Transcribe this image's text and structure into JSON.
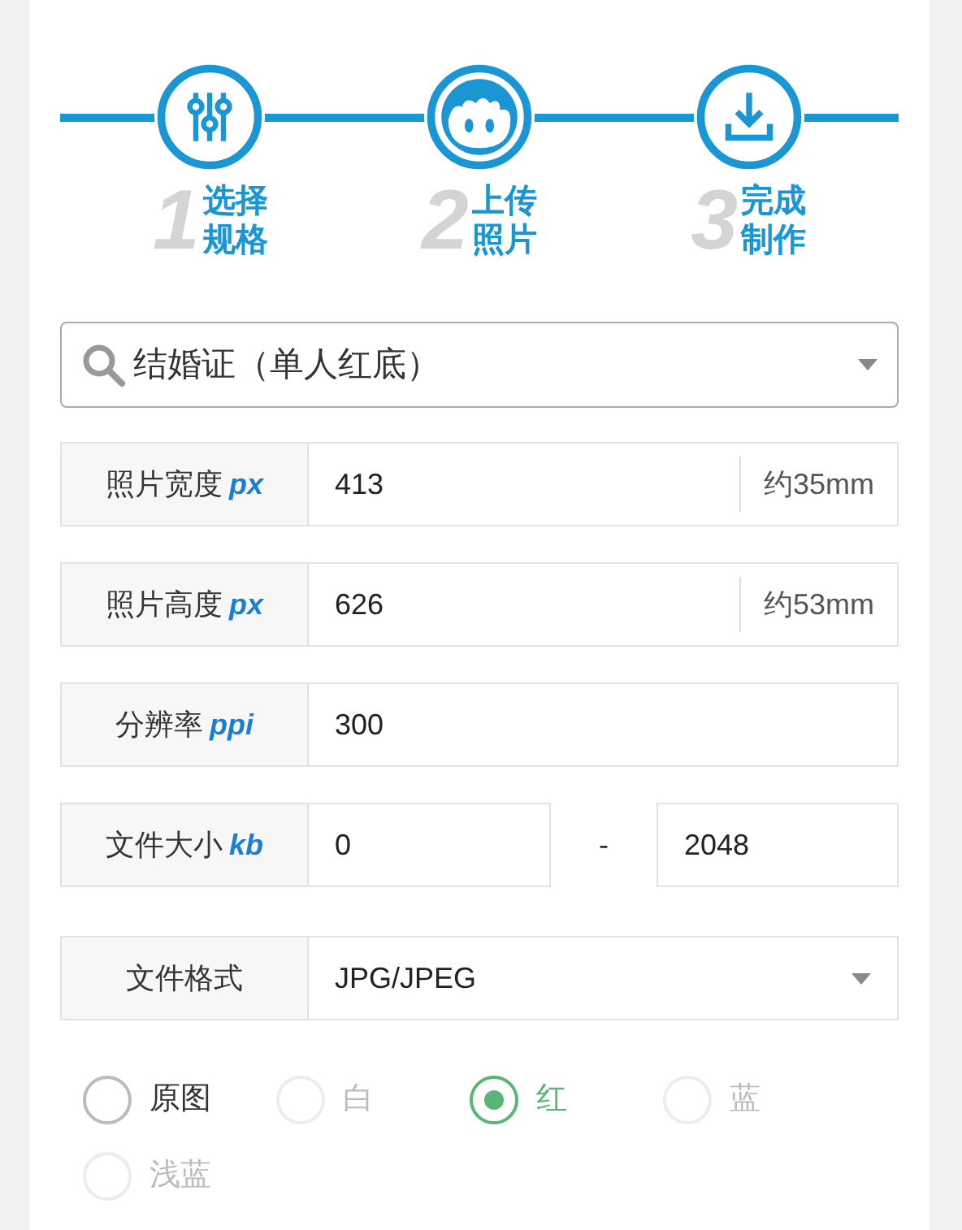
{
  "steps": [
    {
      "number": "1",
      "line1": "选择",
      "line2": "规格",
      "kind": "sliders"
    },
    {
      "number": "2",
      "line1": "上传",
      "line2": "照片",
      "kind": "face"
    },
    {
      "number": "3",
      "line1": "完成",
      "line2": "制作",
      "kind": "download"
    }
  ],
  "spec_select": {
    "value": "结婚证（单人红底）"
  },
  "fields": [
    {
      "kind": "unit",
      "label": "照片宽度",
      "unit": "px",
      "value": "413",
      "suffix": "约35mm"
    },
    {
      "kind": "unit",
      "label": "照片高度",
      "unit": "px",
      "value": "626",
      "suffix": "约53mm"
    },
    {
      "kind": "plain",
      "label": "分辨率",
      "unit": "ppi",
      "value": "300"
    },
    {
      "kind": "range",
      "label": "文件大小",
      "unit": "kb",
      "value": "0",
      "separator": "-",
      "value2": "2048"
    },
    {
      "kind": "select",
      "label": "文件格式",
      "value": "JPG/JPEG"
    }
  ],
  "backgrounds": [
    {
      "label": "原图",
      "selected": false,
      "disabled": false
    },
    {
      "label": "白",
      "selected": false,
      "disabled": true
    },
    {
      "label": "红",
      "selected": true,
      "disabled": false
    },
    {
      "label": "蓝",
      "selected": false,
      "disabled": true
    },
    {
      "label": "浅蓝",
      "selected": false,
      "disabled": true
    }
  ]
}
